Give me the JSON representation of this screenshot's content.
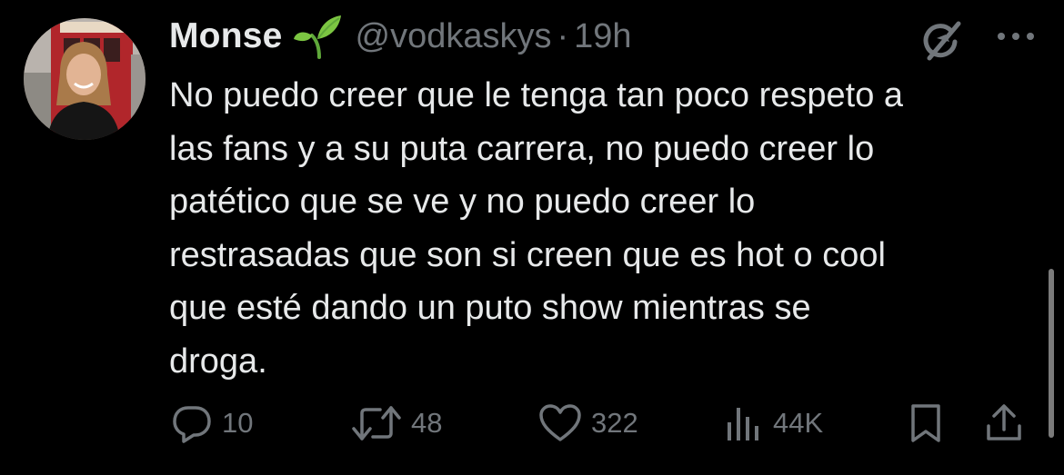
{
  "tweet": {
    "display_name": "Monse",
    "handle": "@vodkaskys",
    "separator": "·",
    "time": "19h",
    "text_lines": [
      "No puedo creer que le tenga tan poco respeto a",
      "las fans y a su puta carrera, no puedo creer lo",
      "patético que se ve y no puedo creer lo",
      "restrasadas que son si creen que es hot o cool",
      "que esté dando un puto show mientras se",
      "droga."
    ]
  },
  "icons": {
    "verified_badge": "sprout-emoji",
    "grok": "grok-icon",
    "more": "more-icon",
    "reply": "reply-icon",
    "retweet": "retweet-icon",
    "like": "heart-icon",
    "views": "views-icon",
    "bookmark": "bookmark-icon",
    "share": "share-icon"
  },
  "actions": {
    "replies": "10",
    "retweets": "48",
    "likes": "322",
    "views": "44K"
  },
  "colors": {
    "background": "#000000",
    "text_primary": "#e7e9ea",
    "text_secondary": "#71767b",
    "sprout_green": "#7cc642"
  }
}
